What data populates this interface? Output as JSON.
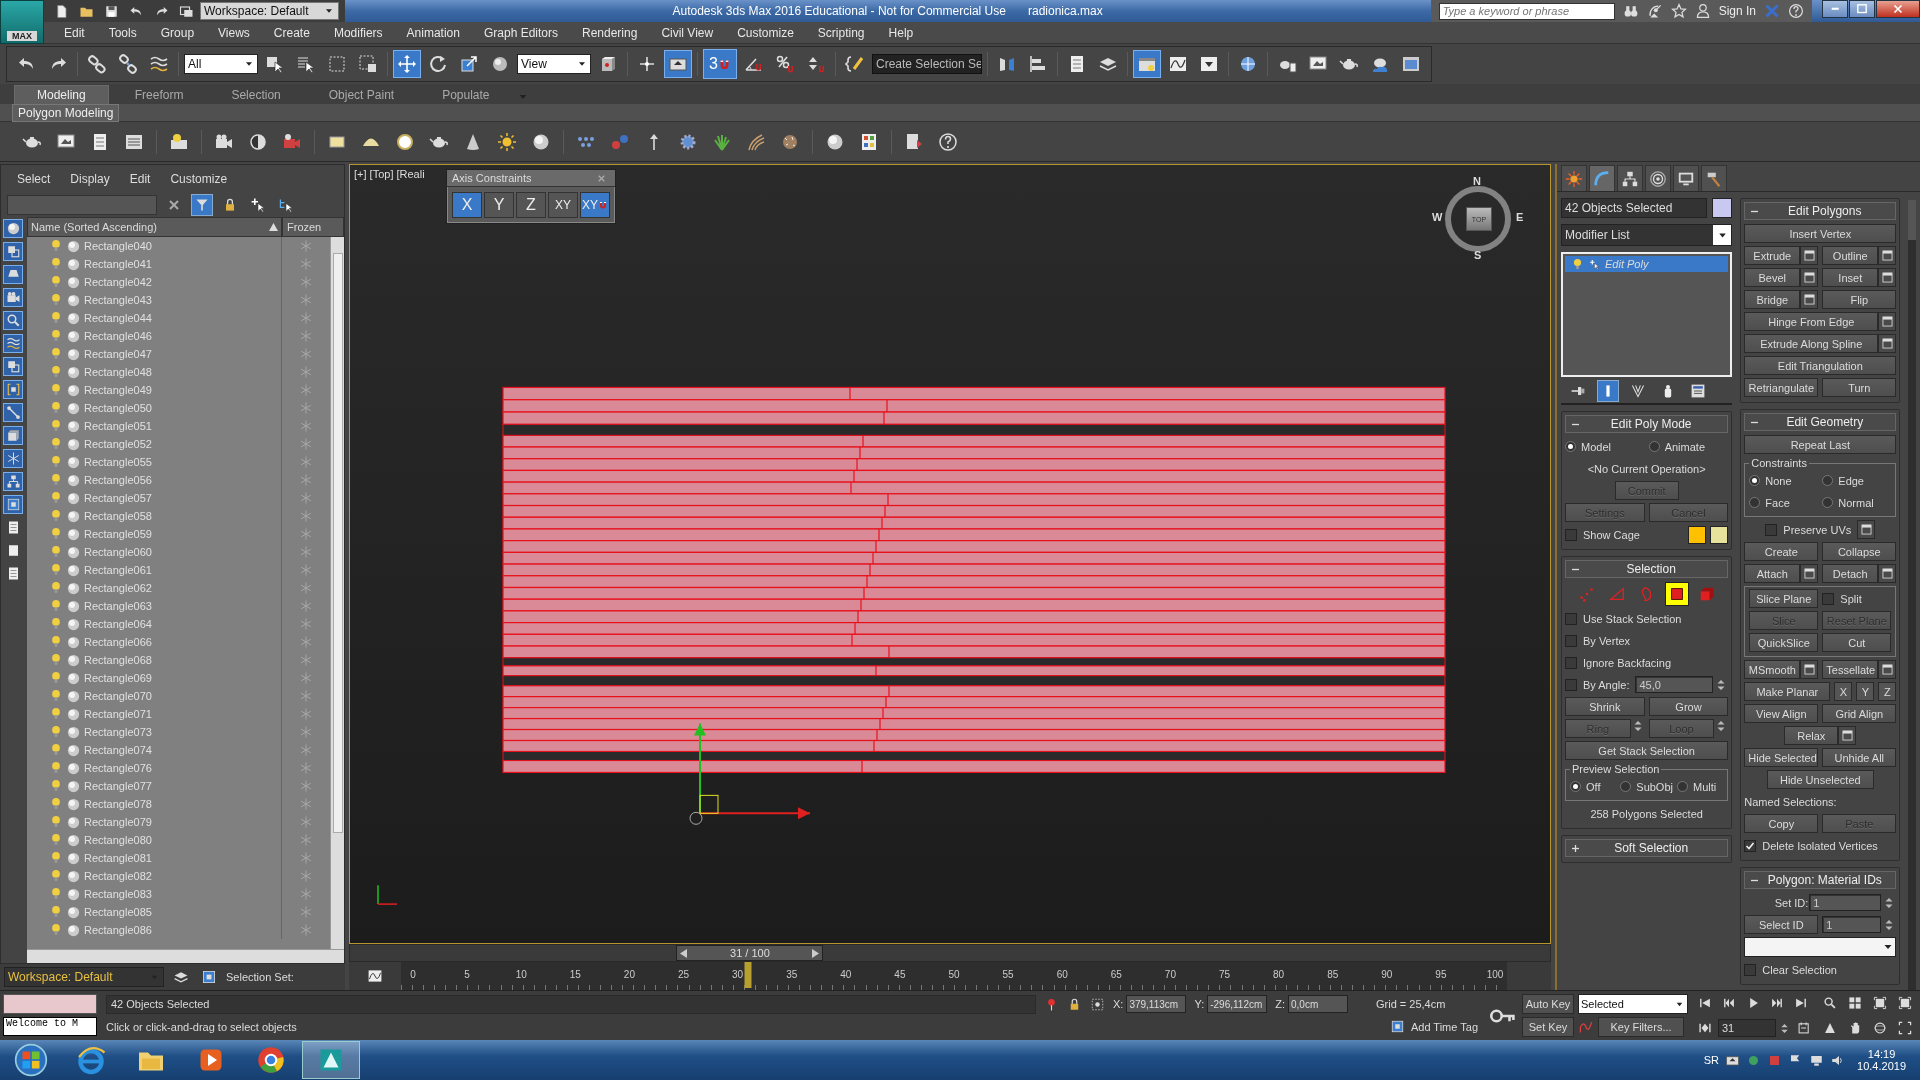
{
  "title_bar": {
    "workspace": "Workspace: Default",
    "title": "Autodesk 3ds Max 2016 Educational - Not for Commercial Use",
    "file": "radionica.max",
    "search": {
      "placeholder": "Type a keyword or phrase"
    },
    "sign_in": "Sign In"
  },
  "logo": "MAX",
  "menu": [
    "Edit",
    "Tools",
    "Group",
    "Views",
    "Create",
    "Modifiers",
    "Animation",
    "Graph Editors",
    "Rendering",
    "Civil View",
    "Customize",
    "Scripting",
    "Help"
  ],
  "main_toolbar": {
    "tools": [
      {
        "selected": false
      },
      {
        "selected": false
      },
      {
        "selected": false
      },
      {
        "selected": false
      },
      {
        "selected": false
      },
      {
        "selected": false
      },
      {
        "selected": false
      },
      {
        "selected": false
      },
      {
        "selected": false
      },
      {
        "selected": true
      },
      {
        "selected": false
      },
      {
        "selected": false
      },
      {
        "selected": false
      },
      {
        "selected": false
      },
      {
        "selected": false
      },
      {
        "selected": true
      },
      {
        "selected": false
      },
      {
        "selected": false
      },
      {
        "selected": false
      },
      {
        "selected": false
      },
      {
        "selected": false
      },
      {
        "selected": false
      },
      {
        "selected": false
      },
      {
        "selected": false
      },
      {
        "selected": true
      },
      {
        "selected": false
      },
      {
        "selected": false
      },
      {
        "selected": false
      },
      {
        "selected": false
      },
      {
        "selected": false
      },
      {
        "selected": false
      },
      {
        "selected": false
      },
      {
        "selected": false
      }
    ],
    "dropdowns": [
      "All",
      "View"
    ],
    "snap": {
      "value": "3",
      "selected": true
    },
    "named_selection": "Create Selection Se"
  },
  "ribbon": {
    "tabs": [
      {
        "label": "Modeling",
        "selected": true
      },
      {
        "label": "Freeform",
        "selected": false
      },
      {
        "label": "Selection",
        "selected": false
      },
      {
        "label": "Object Paint",
        "selected": false
      },
      {
        "label": "Populate",
        "selected": false
      }
    ],
    "panel": "Polygon Modeling"
  },
  "scene_explorer": {
    "menu": [
      "Select",
      "Display",
      "Edit",
      "Customize"
    ],
    "tools": [
      {
        "selected": false
      },
      {
        "selected": true
      },
      {
        "selected": false
      },
      {
        "selected": false
      },
      {
        "selected": false
      }
    ],
    "filters": [
      {
        "selected": true
      },
      {
        "selected": true
      },
      {
        "selected": true
      },
      {
        "selected": true
      },
      {
        "selected": true
      },
      {
        "selected": true
      },
      {
        "selected": true
      },
      {
        "selected": true
      },
      {
        "selected": true
      },
      {
        "selected": true
      },
      {
        "selected": true
      },
      {
        "selected": true
      },
      {
        "selected": true
      },
      {
        "selected": false
      },
      {
        "selected": false
      },
      {
        "selected": false
      }
    ],
    "columns": [
      "Name (Sorted Ascending)",
      "Frozen"
    ],
    "rows": [
      {
        "name": "Rectangle040",
        "frozen": false
      },
      {
        "name": "Rectangle041",
        "frozen": false
      },
      {
        "name": "Rectangle042",
        "frozen": false
      },
      {
        "name": "Rectangle043",
        "frozen": false
      },
      {
        "name": "Rectangle044",
        "frozen": false
      },
      {
        "name": "Rectangle046",
        "frozen": false
      },
      {
        "name": "Rectangle047",
        "frozen": false
      },
      {
        "name": "Rectangle048",
        "frozen": false
      },
      {
        "name": "Rectangle049",
        "frozen": false
      },
      {
        "name": "Rectangle050",
        "frozen": false
      },
      {
        "name": "Rectangle051",
        "frozen": false
      },
      {
        "name": "Rectangle052",
        "frozen": false
      },
      {
        "name": "Rectangle055",
        "frozen": false
      },
      {
        "name": "Rectangle056",
        "frozen": false
      },
      {
        "name": "Rectangle057",
        "frozen": false
      },
      {
        "name": "Rectangle058",
        "frozen": false
      },
      {
        "name": "Rectangle059",
        "frozen": false
      },
      {
        "name": "Rectangle060",
        "frozen": false
      },
      {
        "name": "Rectangle061",
        "frozen": false
      },
      {
        "name": "Rectangle062",
        "frozen": false
      },
      {
        "name": "Rectangle063",
        "frozen": false
      },
      {
        "name": "Rectangle064",
        "frozen": false
      },
      {
        "name": "Rectangle066",
        "frozen": false
      },
      {
        "name": "Rectangle068",
        "frozen": false
      },
      {
        "name": "Rectangle069",
        "frozen": false
      },
      {
        "name": "Rectangle070",
        "frozen": false
      },
      {
        "name": "Rectangle071",
        "frozen": false
      },
      {
        "name": "Rectangle073",
        "frozen": false
      },
      {
        "name": "Rectangle074",
        "frozen": false
      },
      {
        "name": "Rectangle076",
        "frozen": false
      },
      {
        "name": "Rectangle077",
        "frozen": false
      },
      {
        "name": "Rectangle078",
        "frozen": false
      },
      {
        "name": "Rectangle079",
        "frozen": false
      },
      {
        "name": "Rectangle080",
        "frozen": false
      },
      {
        "name": "Rectangle081",
        "frozen": false
      },
      {
        "name": "Rectangle082",
        "frozen": false
      },
      {
        "name": "Rectangle083",
        "frozen": false
      },
      {
        "name": "Rectangle085",
        "frozen": false
      },
      {
        "name": "Rectangle086",
        "frozen": false
      }
    ]
  },
  "viewport": {
    "label": "[+] [Top] [Reali",
    "viewcube": {
      "north": "N",
      "south": "S",
      "east": "E",
      "west": "W",
      "face": "TOP"
    }
  },
  "axis_constraints": {
    "title": "Axis Constraints",
    "buttons": [
      {
        "kind": "axis",
        "label": "X",
        "selected": true
      },
      {
        "kind": "axis",
        "label": "Y",
        "selected": false
      },
      {
        "kind": "axis",
        "label": "Z",
        "selected": false
      },
      {
        "kind": "axis",
        "label": "XY",
        "selected": false
      },
      {
        "kind": "snap",
        "label": "XY",
        "selected": true
      }
    ]
  },
  "time_slider": {
    "frame": "31 / 100",
    "level": 0.31,
    "ticks": [
      "0",
      "5",
      "10",
      "15",
      "20",
      "25",
      "30",
      "35",
      "40",
      "45",
      "50",
      "55",
      "60",
      "65",
      "70",
      "75",
      "80",
      "85",
      "90",
      "95",
      "100"
    ]
  },
  "workspace_bar": {
    "workspace": "Workspace: Default",
    "selection_set": "Selection Set:"
  },
  "command_panel": {
    "tabs": [
      {
        "selected": false
      },
      {
        "selected": true
      },
      {
        "selected": false
      },
      {
        "selected": false
      },
      {
        "selected": false
      },
      {
        "selected": false
      }
    ],
    "object_name": "42 Objects Selected",
    "modifier_list": "Modifier List",
    "stack": [
      {
        "label": "Edit Poly",
        "selected": true
      }
    ],
    "stack_tools": [
      {
        "selected": false
      },
      {
        "selected": true
      },
      {
        "selected": false
      },
      {
        "selected": false
      },
      {
        "selected": false
      }
    ],
    "left_rollouts": [
      {
        "title": "Edit Poly Mode",
        "expanded": true,
        "rows": [
          [
            {
              "kind": "radio",
              "label": "Model",
              "selected": true
            },
            {
              "kind": "radio",
              "label": "Animate",
              "selected": false
            }
          ],
          [
            {
              "kind": "status",
              "text": "<No Current Operation>"
            }
          ],
          [
            {
              "kind": "short_button",
              "label": "Commit",
              "disabled": true,
              "settings": false
            }
          ],
          [
            {
              "kind": "button",
              "label": "Settings",
              "disabled": true,
              "settings": false
            },
            {
              "kind": "button",
              "label": "Cancel",
              "disabled": true,
              "settings": false
            }
          ],
          [
            {
              "kind": "check",
              "label": "Show Cage",
              "checked": false
            },
            {
              "kind": "swatches"
            }
          ]
        ]
      },
      {
        "title": "Selection",
        "expanded": true,
        "rows": [
          [
            {
              "kind": "levels",
              "levels": [
                {
                  "selected": false
                },
                {
                  "selected": false
                },
                {
                  "selected": false
                },
                {
                  "selected": true
                },
                {
                  "selected": false
                }
              ]
            }
          ],
          [
            {
              "kind": "check",
              "label": "Use Stack Selection",
              "checked": false
            }
          ],
          [
            {
              "kind": "check",
              "label": "By Vertex",
              "checked": false
            }
          ],
          [
            {
              "kind": "check",
              "label": "Ignore Backfacing",
              "checked": false
            }
          ],
          [
            {
              "kind": "check_spin",
              "label": "By Angle:",
              "checked": false,
              "value": "45,0"
            }
          ],
          [
            {
              "kind": "button",
              "label": "Shrink",
              "disabled": false,
              "settings": false
            },
            {
              "kind": "button",
              "label": "Grow",
              "disabled": false,
              "settings": false
            }
          ],
          [
            {
              "kind": "stepper_button",
              "label": "Ring",
              "disabled": true,
              "settings": false
            },
            {
              "kind": "stepper_button",
              "label": "Loop",
              "disabled": true,
              "settings": false
            }
          ],
          [
            {
              "kind": "button",
              "label": "Get Stack Selection",
              "disabled": false,
              "settings": false
            }
          ],
          [
            {
              "kind": "group",
              "title": "Preview Selection",
              "rows": [
                [
                  {
                    "kind": "radio",
                    "label": "Off",
                    "selected": true
                  },
                  {
                    "kind": "radio",
                    "label": "SubObj",
                    "selected": false
                  },
                  {
                    "kind": "radio",
                    "label": "Multi",
                    "selected": false
                  }
                ]
              ]
            }
          ],
          [
            {
              "kind": "status",
              "text": "258 Polygons Selected"
            }
          ]
        ]
      },
      {
        "title": "Soft Selection",
        "expanded": false
      }
    ],
    "right_rollouts": [
      {
        "title": "Edit Polygons",
        "expanded": true,
        "rows": [
          [
            {
              "kind": "button",
              "label": "Insert Vertex",
              "disabled": false,
              "settings": false
            }
          ],
          [
            {
              "kind": "button",
              "label": "Extrude",
              "disabled": false,
              "settings": true
            },
            {
              "kind": "button",
              "label": "Outline",
              "disabled": false,
              "settings": true
            }
          ],
          [
            {
              "kind": "button",
              "label": "Bevel",
              "disabled": false,
              "settings": true
            },
            {
              "kind": "button",
              "label": "Inset",
              "disabled": false,
              "settings": true
            }
          ],
          [
            {
              "kind": "button",
              "label": "Bridge",
              "disabled": false,
              "settings": true
            },
            {
              "kind": "button",
              "label": "Flip",
              "disabled": false,
              "settings": false
            }
          ],
          [
            {
              "kind": "button",
              "label": "Hinge From Edge",
              "disabled": false,
              "settings": true
            }
          ],
          [
            {
              "kind": "button",
              "label": "Extrude Along Spline",
              "disabled": false,
              "settings": true
            }
          ],
          [
            {
              "kind": "button",
              "label": "Edit Triangulation",
              "disabled": false,
              "settings": false
            }
          ],
          [
            {
              "kind": "button",
              "label": "Retriangulate",
              "disabled": false,
              "settings": false
            },
            {
              "kind": "button",
              "label": "Turn",
              "disabled": false,
              "settings": false
            }
          ]
        ]
      },
      {
        "title": "Edit Geometry",
        "expanded": true,
        "rows": [
          [
            {
              "kind": "button",
              "label": "Repeat Last",
              "disabled": false,
              "settings": false
            }
          ],
          [
            {
              "kind": "group",
              "title": "Constraints",
              "rows": [
                [
                  {
                    "kind": "radio",
                    "label": "None",
                    "selected": true
                  },
                  {
                    "kind": "radio",
                    "label": "Edge",
                    "selected": false
                  }
                ],
                [
                  {
                    "kind": "radio",
                    "label": "Face",
                    "selected": false
                  },
                  {
                    "kind": "radio",
                    "label": "Normal",
                    "selected": false
                  }
                ]
              ]
            }
          ],
          [
            {
              "kind": "check_settings",
              "label": "Preserve UVs",
              "checked": false
            }
          ],
          [
            {
              "kind": "button",
              "label": "Create",
              "disabled": false,
              "settings": false
            },
            {
              "kind": "button",
              "label": "Collapse",
              "disabled": false,
              "settings": false
            }
          ],
          [
            {
              "kind": "button",
              "label": "Attach",
              "disabled": false,
              "settings": true
            },
            {
              "kind": "button",
              "label": "Detach",
              "disabled": false,
              "settings": true
            }
          ],
          [
            {
              "kind": "group",
              "rows": [
                [
                  {
                    "kind": "button",
                    "label": "Slice Plane",
                    "disabled": false,
                    "settings": false
                  },
                  {
                    "kind": "check",
                    "label": "Split",
                    "checked": false
                  }
                ],
                [
                  {
                    "kind": "button",
                    "label": "Slice",
                    "disabled": true,
                    "settings": false
                  },
                  {
                    "kind": "button",
                    "label": "Reset Plane",
                    "disabled": true,
                    "settings": false
                  }
                ],
                [
                  {
                    "kind": "button",
                    "label": "QuickSlice",
                    "disabled": false,
                    "settings": false
                  },
                  {
                    "kind": "button",
                    "label": "Cut",
                    "disabled": false,
                    "settings": false
                  }
                ]
              ]
            }
          ],
          [
            {
              "kind": "button",
              "label": "MSmooth",
              "disabled": false,
              "settings": true
            },
            {
              "kind": "button",
              "label": "Tessellate",
              "disabled": false,
              "settings": true
            }
          ],
          [
            {
              "kind": "button",
              "label": "Make Planar",
              "disabled": false,
              "settings": false
            },
            {
              "kind": "mini",
              "label": "X",
              "disabled": false,
              "settings": false
            },
            {
              "kind": "mini",
              "label": "Y",
              "disabled": false,
              "settings": false
            },
            {
              "kind": "mini",
              "label": "Z",
              "disabled": false,
              "settings": false
            }
          ],
          [
            {
              "kind": "button",
              "label": "View Align",
              "disabled": false,
              "settings": false
            },
            {
              "kind": "button",
              "label": "Grid Align",
              "disabled": false,
              "settings": false
            }
          ],
          [
            {
              "kind": "short_button",
              "label": "Relax",
              "disabled": false,
              "settings": true
            }
          ],
          [
            {
              "kind": "button",
              "label": "Hide Selected",
              "disabled": false,
              "settings": false
            },
            {
              "kind": "button",
              "label": "Unhide All",
              "disabled": false,
              "settings": false
            }
          ],
          [
            {
              "kind": "short_button",
              "label": "Hide Unselected",
              "disabled": false,
              "settings": false
            }
          ],
          [
            {
              "kind": "caption",
              "text": "Named Selections:"
            }
          ],
          [
            {
              "kind": "button",
              "label": "Copy",
              "disabled": false,
              "settings": false
            },
            {
              "kind": "button",
              "label": "Paste",
              "disabled": true,
              "settings": false
            }
          ],
          [
            {
              "kind": "check",
              "label": "Delete Isolated Vertices",
              "checked": true
            }
          ]
        ]
      },
      {
        "title": "Polygon: Material IDs",
        "expanded": true,
        "rows": [
          [
            {
              "kind": "spin",
              "label": "Set ID:",
              "value": "1"
            }
          ],
          [
            {
              "kind": "button",
              "label": "Select ID",
              "disabled": false,
              "settings": false
            },
            {
              "kind": "spin",
              "value": "1"
            }
          ],
          [
            {
              "kind": "dropdown"
            }
          ],
          [
            {
              "kind": "check",
              "label": "Clear Selection",
              "checked": false
            }
          ]
        ]
      }
    ]
  },
  "status_bar": {
    "prompt": "42 Objects Selected",
    "hint": "Click or click-and-drag to select objects",
    "listener": "Welcome to M",
    "coords": [
      {
        "axis": "X:",
        "value": "379,113cm"
      },
      {
        "axis": "Y:",
        "value": "-296,112cm"
      },
      {
        "axis": "Z:",
        "value": "0,0cm"
      }
    ],
    "grid": "Grid = 25,4cm",
    "time_tag": "Add Time Tag",
    "auto_key": "Auto Key",
    "set_key": "Set Key",
    "key_set": "Selected",
    "key_filters": "Key Filters...",
    "frame": "31"
  },
  "taskbar": {
    "apps": [
      {
        "selected": false
      },
      {
        "selected": false
      },
      {
        "selected": false
      },
      {
        "selected": false
      },
      {
        "selected": true
      }
    ],
    "language": "SR",
    "time": "14:19",
    "date": "10.4.2019"
  }
}
